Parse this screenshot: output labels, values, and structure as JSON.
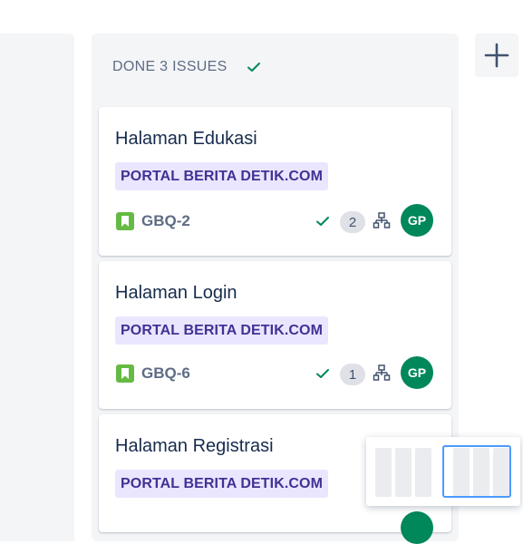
{
  "column": {
    "title": "DONE 3 ISSUES",
    "status_icon": "check-icon",
    "accent": "#00875a"
  },
  "add_column": {
    "icon": "plus-icon"
  },
  "cards": [
    {
      "title": "Halaman Edukasi",
      "epic": "PORTAL BERITA DETIK.COM",
      "key": "GBQ-2",
      "subtask_count": "2",
      "assignee": "GP"
    },
    {
      "title": "Halaman Login",
      "epic": "PORTAL BERITA DETIK.COM",
      "key": "GBQ-6",
      "subtask_count": "1",
      "assignee": "GP"
    },
    {
      "title": "Halaman Registrasi",
      "epic": "PORTAL BERITA DETIK.COM"
    }
  ],
  "colors": {
    "story": "#65ba43",
    "epic_bg": "#eae6ff",
    "epic_text": "#403294",
    "avatar": "#00875a",
    "minimap_border": "#4c9aff"
  }
}
